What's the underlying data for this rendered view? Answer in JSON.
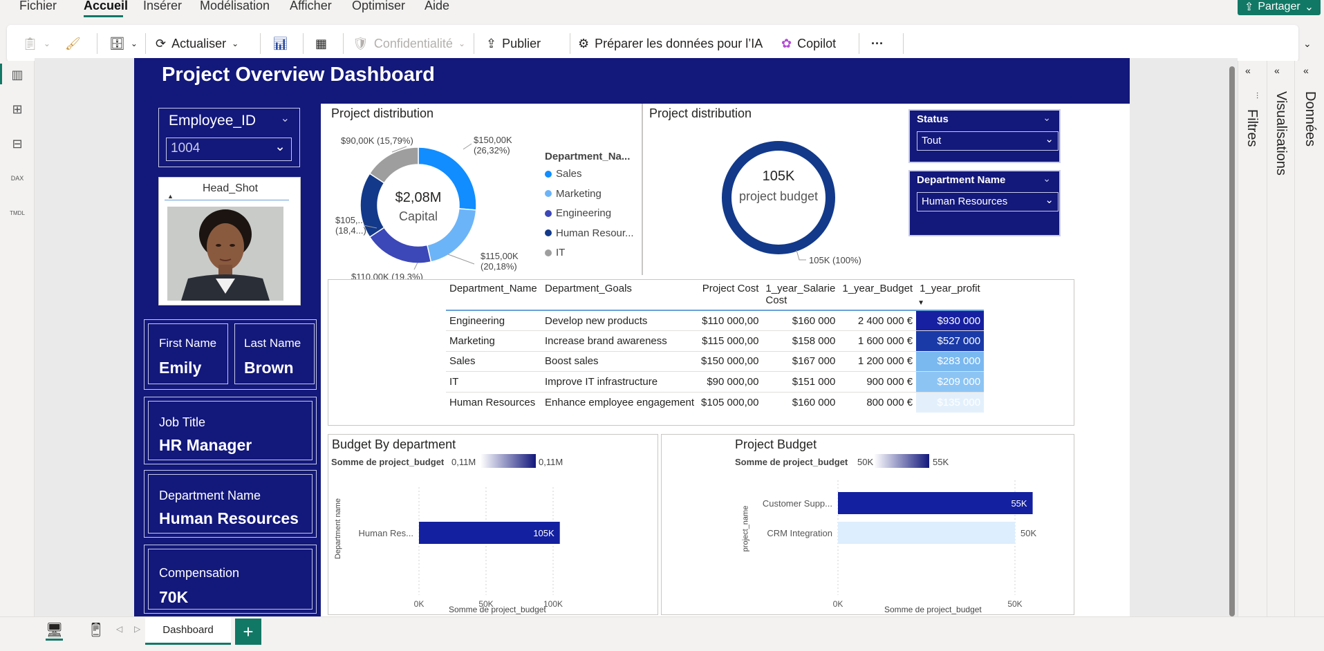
{
  "menu": {
    "items": [
      "Fichier",
      "Accueil",
      "Insérer",
      "Modélisation",
      "Afficher",
      "Optimiser",
      "Aide"
    ],
    "active": "Accueil",
    "share": "Partager"
  },
  "ribbon": {
    "refresh": "Actualiser",
    "confidentiality": "Confidentialité",
    "publish": "Publier",
    "prepare_ai": "Préparer les données pour l’IA",
    "copilot": "Copilot",
    "more": "···"
  },
  "report": {
    "title": "Project Overview Dashboard",
    "employee_slicer": {
      "title": "Employee_ID",
      "value": "1004"
    },
    "headshot": {
      "title": "Head_Shot"
    },
    "cards": {
      "first_name": {
        "label": "First Name",
        "value": "Emily"
      },
      "last_name": {
        "label": "Last Name",
        "value": "Brown"
      },
      "job_title": {
        "label": "Job Title",
        "value": "HR Manager"
      },
      "department": {
        "label": "Department Name",
        "value": "Human Resources"
      },
      "compensation": {
        "label": "Compensation",
        "value": "70K"
      }
    },
    "donut1": {
      "title": "Project distribution",
      "center_value": "$2,08M",
      "center_label": "Capital",
      "legend_title": "Department_Na...",
      "legend": [
        "Sales",
        "Marketing",
        "Engineering",
        "Human Resour...",
        "IT"
      ],
      "labels": {
        "sales": [
          "$150,00K",
          "(26,32%)"
        ],
        "marketing": [
          "$115,00K",
          "(20,18%)"
        ],
        "engineering": "$110,00K (19,3%)",
        "hr": [
          "$105,...",
          "(18,4...)"
        ],
        "it": "$90,00K (15,79%)"
      }
    },
    "donut2": {
      "title": "Project distribution",
      "center_value": "105K",
      "center_label": "project budget",
      "label": "105K (100%)"
    },
    "status_slicer": {
      "title": "Status",
      "value": "Tout"
    },
    "dept_slicer": {
      "title": "Department Name",
      "value": "Human Resources"
    },
    "matrix": {
      "headers": [
        "Department_Name",
        "Department_Goals",
        "Project Cost",
        "1_year_Salarie Cost",
        "1_year_Budget",
        "1_year_profit"
      ],
      "rows": [
        {
          "dept": "Engineering",
          "goal": "Develop new products",
          "cost": "$110 000,00",
          "salary": "$160 000",
          "budget": "2 400 000 €",
          "profit": "$930 000",
          "profit_color": "#1620a0"
        },
        {
          "dept": "Marketing",
          "goal": "Increase brand awareness",
          "cost": "$115 000,00",
          "salary": "$158 000",
          "budget": "1 600 000 €",
          "profit": "$527 000",
          "profit_color": "#1a3aa8"
        },
        {
          "dept": "Sales",
          "goal": "Boost sales",
          "cost": "$150 000,00",
          "salary": "$167 000",
          "budget": "1 200 000 €",
          "profit": "$283 000",
          "profit_color": "#7ab8f0"
        },
        {
          "dept": "IT",
          "goal": "Improve IT infrastructure",
          "cost": "$90 000,00",
          "salary": "$151 000",
          "budget": "900 000 €",
          "profit": "$209 000",
          "profit_color": "#8cc4f4"
        },
        {
          "dept": "Human Resources",
          "goal": "Enhance employee engagement",
          "cost": "$105 000,00",
          "salary": "$160 000",
          "budget": "800 000 €",
          "profit": "$135 000",
          "profit_color": "#e3f0fc"
        }
      ]
    },
    "budget_chart": {
      "title": "Budget By department",
      "legend_label": "Somme de project_budget",
      "legend_min": "0,11M",
      "legend_max": "0,11M",
      "ylabel": "Department name",
      "xlabel": "Somme de project_budget",
      "ticks": [
        "0K",
        "50K",
        "100K"
      ],
      "bar_label": "Human Res...",
      "bar_value": "105K"
    },
    "project_chart": {
      "title": "Project Budget",
      "legend_label": "Somme de project_budget",
      "legend_min": "50K",
      "legend_max": "55K",
      "ylabel": "project_name",
      "xlabel": "Somme de project_budget",
      "ticks": [
        "0K",
        "50K"
      ],
      "bars": [
        {
          "label": "Customer Supp...",
          "value": "55K"
        },
        {
          "label": "CRM Integration",
          "value": "50K"
        }
      ]
    }
  },
  "panes": {
    "filters": "Filtres",
    "visualizations": "Visualisations",
    "data": "Données"
  },
  "bottom": {
    "page_tab": "Dashboard",
    "add": "+"
  },
  "chart_data": [
    {
      "type": "pie",
      "title": "Project distribution",
      "categories": [
        "Sales",
        "Marketing",
        "Engineering",
        "Human Resources",
        "IT"
      ],
      "values": [
        150000,
        115000,
        110000,
        105000,
        90000
      ],
      "colors": [
        "#118dff",
        "#6cb4f8",
        "#3c47b8",
        "#12398a",
        "#9e9e9e"
      ]
    },
    {
      "type": "pie",
      "title": "Project distribution",
      "categories": [
        "Human Resources"
      ],
      "values": [
        105000
      ],
      "colors": [
        "#12398a"
      ]
    },
    {
      "type": "bar",
      "title": "Budget By department",
      "categories": [
        "Human Res..."
      ],
      "values": [
        105000
      ],
      "xlim": [
        0,
        110000
      ]
    },
    {
      "type": "bar",
      "title": "Project Budget",
      "categories": [
        "Customer Supp...",
        "CRM Integration"
      ],
      "values": [
        55000,
        50000
      ],
      "xlim": [
        0,
        55000
      ]
    }
  ]
}
